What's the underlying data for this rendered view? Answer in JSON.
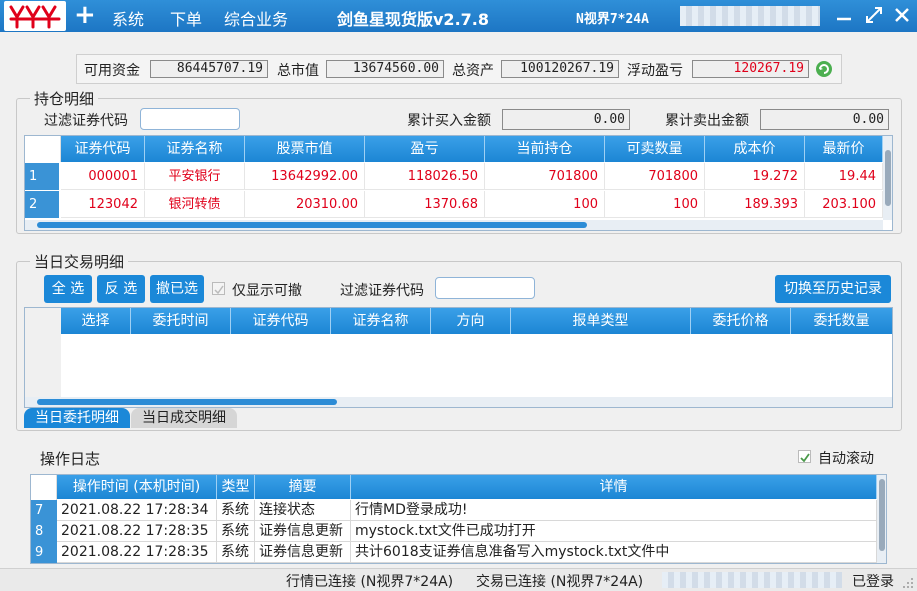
{
  "titlebar": {
    "menu": [
      "系统",
      "下单",
      "综合业务"
    ],
    "title": "剑鱼星现货版v2.7.8",
    "server": "N视界7*24A",
    "min_icon": "minimize-icon",
    "max_icon": "maximize-icon",
    "close_icon": "close-icon"
  },
  "summary": {
    "available_label": "可用资金",
    "available_value": "86445707.19",
    "market_label": "总市值",
    "market_value": "13674560.00",
    "total_label": "总资产",
    "total_value": "100120267.19",
    "pnl_label": "浮动盈亏",
    "pnl_value": "120267.19",
    "pnl_color": "#e0001a",
    "refresh_icon": "refresh-icon"
  },
  "positions": {
    "title": "持仓明细",
    "filter_label": "过滤证券代码",
    "filter_value": "",
    "buy_label": "累计买入金额",
    "buy_value": "0.00",
    "sell_label": "累计卖出金额",
    "sell_value": "0.00",
    "columns": [
      "证券代码",
      "证券名称",
      "股票市值",
      "盈亏",
      "当前持仓",
      "可卖数量",
      "成本价",
      "最新价"
    ],
    "rows": [
      {
        "index": "1",
        "code": "000001",
        "name": "平安银行",
        "market": "13642992.00",
        "pnl": "118026.50",
        "hold": "701800",
        "sellable": "701800",
        "cost": "19.272",
        "last": "19.44"
      },
      {
        "index": "2",
        "code": "123042",
        "name": "银河转债",
        "market": "20310.00",
        "pnl": "1370.68",
        "hold": "100",
        "sellable": "100",
        "cost": "189.393",
        "last": "203.100"
      }
    ]
  },
  "today": {
    "title": "当日交易明细",
    "select_all": "全 选",
    "invert": "反 选",
    "cancel_selected": "撤已选",
    "only_cancelable": "仅显示可撤",
    "filter_label": "过滤证券代码",
    "filter_value": "",
    "switch_history": "切换至历史记录",
    "columns": [
      "选择",
      "委托时间",
      "证券代码",
      "证券名称",
      "方向",
      "报单类型",
      "委托价格",
      "委托数量"
    ],
    "tab_orders": "当日委托明细",
    "tab_trades": "当日成交明细"
  },
  "log": {
    "title": "操作日志",
    "auto_scroll": "自动滚动",
    "columns": [
      "操作时间 (本机时间)",
      "类型",
      "摘要",
      "详情"
    ],
    "rows": [
      {
        "index": "7",
        "time": "2021.08.22 17:28:34",
        "type": "系统",
        "summary": "连接状态",
        "detail": "行情MD登录成功!"
      },
      {
        "index": "8",
        "time": "2021.08.22 17:28:35",
        "type": "系统",
        "summary": "证券信息更新",
        "detail": "mystock.txt文件已成功打开"
      },
      {
        "index": "9",
        "time": "2021.08.22 17:28:35",
        "type": "系统",
        "summary": "证券信息更新",
        "detail": "共计6018支证券信息准备写入mystock.txt文件中"
      }
    ]
  },
  "status": {
    "md": "行情已连接 (N视界7*24A)",
    "td": "交易已连接 (N视界7*24A)",
    "login": "已登录"
  }
}
